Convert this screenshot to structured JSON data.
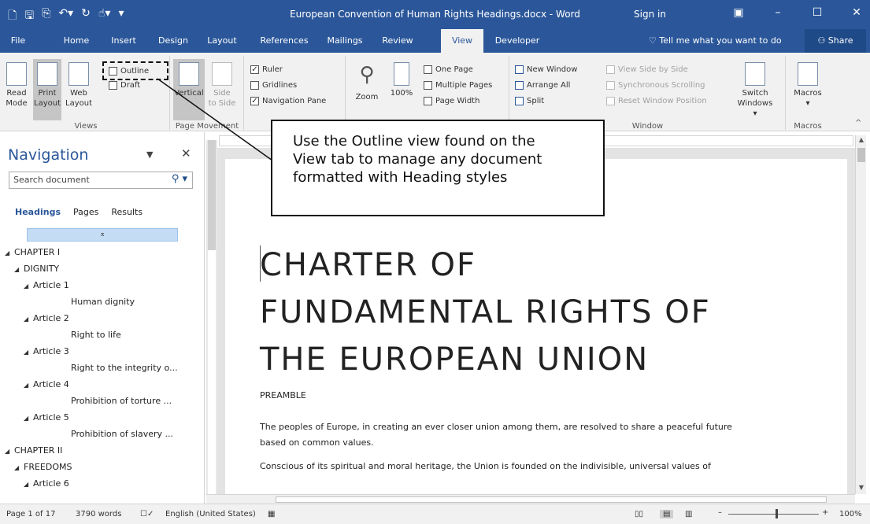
{
  "titlebar": {
    "title": "European Convention of Human Rights Headings.docx - Word",
    "sign_in": "Sign in",
    "quick_access": [
      "new-doc-icon",
      "save-icon",
      "save-as-icon",
      "undo-icon",
      "redo-icon",
      "touch-mode-icon",
      "customize-icon"
    ]
  },
  "tabs": [
    {
      "label": "File"
    },
    {
      "label": "Home"
    },
    {
      "label": "Insert"
    },
    {
      "label": "Design"
    },
    {
      "label": "Layout"
    },
    {
      "label": "References"
    },
    {
      "label": "Mailings"
    },
    {
      "label": "Review"
    },
    {
      "label": "View"
    },
    {
      "label": "Developer"
    }
  ],
  "tell_me": "Tell me what you want to do",
  "share": "Share",
  "ribbon": {
    "views": {
      "read_mode_1": "Read",
      "read_mode_2": "Mode",
      "print_layout_1": "Print",
      "print_layout_2": "Layout",
      "web_layout_1": "Web",
      "web_layout_2": "Layout",
      "outline": "Outline",
      "draft": "Draft",
      "label": "Views"
    },
    "page_movement": {
      "vertical": "Vertical",
      "side_1": "Side",
      "side_2": "to Side",
      "label": "Page Movement"
    },
    "show": {
      "ruler": "Ruler",
      "gridlines": "Gridlines",
      "navigation_pane": "Navigation Pane"
    },
    "zoom": {
      "zoom": "Zoom",
      "hundred": "100%",
      "one_page": "One Page",
      "multiple_pages": "Multiple Pages",
      "page_width": "Page Width"
    },
    "window": {
      "new_window": "New Window",
      "arrange_all": "Arrange All",
      "split": "Split",
      "view_side_by_side": "View Side by Side",
      "sync_scrolling": "Synchronous Scrolling",
      "reset_window": "Reset Window Position",
      "switch_1": "Switch",
      "switch_2": "Windows",
      "label": "Window"
    },
    "macros": {
      "label_btn": "Macros",
      "label": "Macros"
    }
  },
  "navigation": {
    "title": "Navigation",
    "search_placeholder": "Search document",
    "tabs": [
      "Headings",
      "Pages",
      "Results"
    ],
    "tree": [
      {
        "text": "CHAPTER I",
        "level": 0,
        "tri": true
      },
      {
        "text": "DIGNITY",
        "level": 1,
        "tri": true
      },
      {
        "text": "Article 1",
        "level": 2,
        "tri": true
      },
      {
        "text": "Human dignity",
        "level": 3,
        "tri": false
      },
      {
        "text": "Article 2",
        "level": 2,
        "tri": true
      },
      {
        "text": "Right to life",
        "level": 3,
        "tri": false
      },
      {
        "text": "Article 3",
        "level": 2,
        "tri": true
      },
      {
        "text": "Right to the integrity o...",
        "level": 3,
        "tri": false
      },
      {
        "text": "Article 4",
        "level": 2,
        "tri": true
      },
      {
        "text": "Prohibition of torture ...",
        "level": 3,
        "tri": false
      },
      {
        "text": "Article 5",
        "level": 2,
        "tri": true
      },
      {
        "text": "Prohibition of slavery ...",
        "level": 3,
        "tri": false
      },
      {
        "text": "CHAPTER II",
        "level": 0,
        "tri": true
      },
      {
        "text": "FREEDOMS",
        "level": 1,
        "tri": true
      },
      {
        "text": "Article 6",
        "level": 2,
        "tri": true
      }
    ]
  },
  "document": {
    "title_line_1": "CHARTER OF",
    "title_line_2": "FUNDAMENTAL RIGHTS OF",
    "title_line_3": "THE EUROPEAN UNION",
    "preamble": "PREAMBLE",
    "para1_line1": "The peoples of Europe, in creating an ever closer union among them, are resolved to share a peaceful future",
    "para1_line2": "based on common values.",
    "para2_line1": "Conscious of its spiritual and moral heritage, the Union is founded on the indivisible, universal values of"
  },
  "callout": {
    "line1": "Use the Outline view found on the",
    "line2": "View tab to manage any document",
    "line3": "formatted with Heading styles"
  },
  "statusbar": {
    "page": "Page 1 of 17",
    "words": "3790 words",
    "language": "English (United States)",
    "zoom": "100%"
  },
  "colors": {
    "accent": "#2b579a",
    "ribbon_bg": "#f1f1f1",
    "selected_nav": "#c5dcf5"
  }
}
